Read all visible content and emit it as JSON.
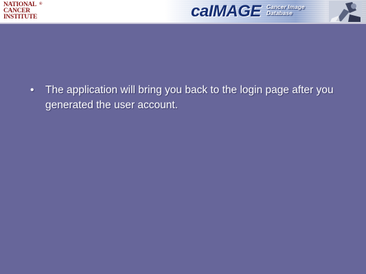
{
  "header": {
    "nci_logo": {
      "lines": [
        "NATIONAL",
        "CANCER",
        "INSTITUTE"
      ],
      "icon": "nci-logo-icon"
    },
    "banner": {
      "title": "caIMAGE",
      "subtitle_line1": "Cancer Image",
      "subtitle_line2": "Database",
      "icon": "microscope-icon"
    }
  },
  "slide": {
    "bullets": [
      {
        "symbol": "•",
        "text": "The application will bring you back to the login page after you generated the user account."
      }
    ]
  },
  "colors": {
    "background": "#67669a",
    "header_bg": "#ffffff",
    "logo_text": "#8a1a1a",
    "banner_title": "#162f73",
    "text": "#ffffff"
  }
}
